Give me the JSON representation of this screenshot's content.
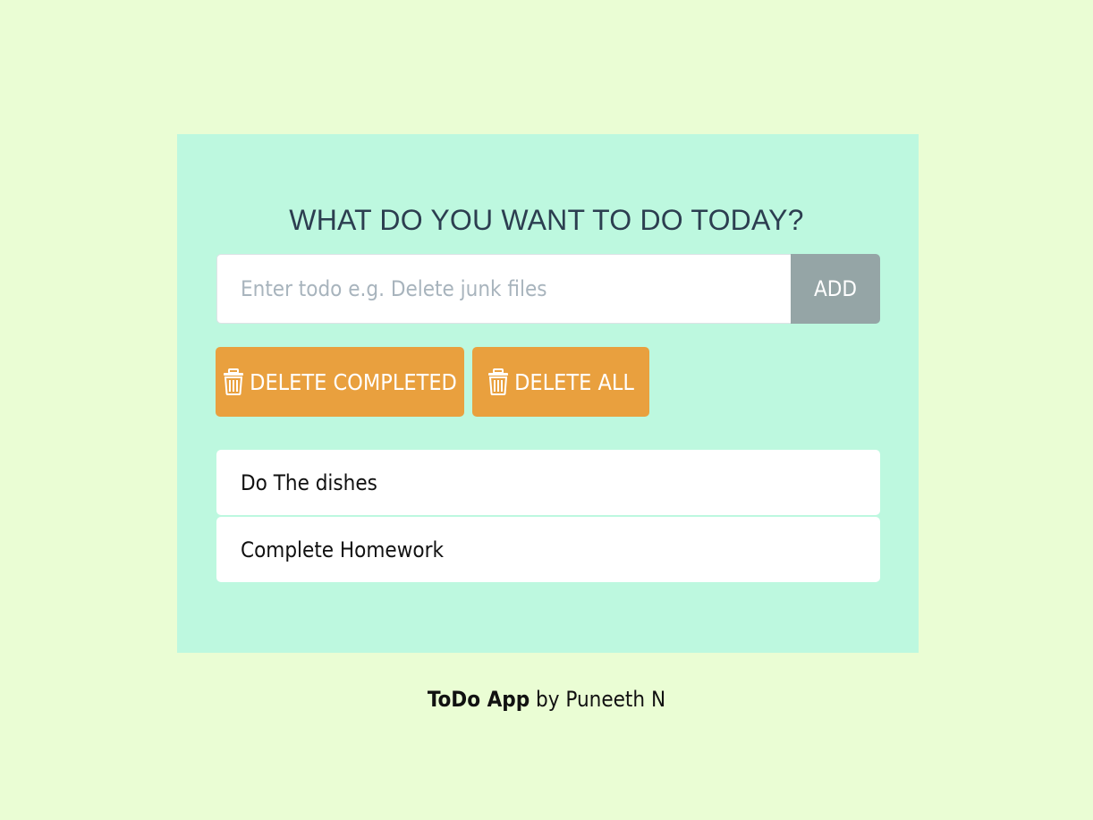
{
  "heading": "WHAT DO YOU WANT TO DO TODAY?",
  "input": {
    "placeholder": "Enter todo e.g. Delete junk files",
    "value": ""
  },
  "add_label": "ADD",
  "actions": {
    "delete_completed_label": "DELETE COMPLETED",
    "delete_all_label": "DELETE ALL",
    "icon": "trash-icon"
  },
  "todos": [
    {
      "label": "Do The dishes"
    },
    {
      "label": "Complete Homework"
    }
  ],
  "footer": {
    "brand": "ToDo App",
    "byline": " by Puneeth N"
  },
  "colors": {
    "page_background": "#eafdd4",
    "panel_background": "#bdf8df",
    "heading_text": "#2c3e50",
    "add_button": "#95a5a6",
    "action_button": "#e9a03e",
    "placeholder": "#a8b4bd"
  }
}
